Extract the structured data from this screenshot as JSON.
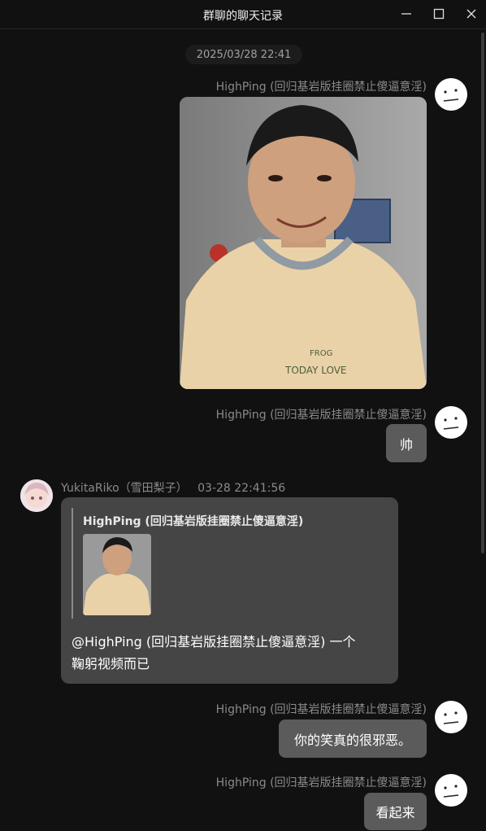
{
  "window": {
    "title": "群聊的聊天记录"
  },
  "timestamp": "2025/03/28 22:41",
  "messages": [
    {
      "sender": "HighPing (回归基岩版挂圈禁止傻逼意淫)",
      "type": "image"
    },
    {
      "sender": "HighPing (回归基岩版挂圈禁止傻逼意淫)",
      "text": "帅"
    },
    {
      "sender": "YukitaRiko（雪田梨子）",
      "time": "03-28 22:41:56",
      "quote_sender": "HighPing (回归基岩版挂圈禁止傻逼意淫)",
      "text_line1": "@HighPing (回归基岩版挂圈禁止傻逼意淫) 一个",
      "text_line2": "鞠躬视频而已"
    },
    {
      "sender": "HighPing (回归基岩版挂圈禁止傻逼意淫)",
      "text": "你的笑真的很邪恶。"
    },
    {
      "sender": "HighPing (回归基岩版挂圈禁止傻逼意淫)",
      "text": "看起来"
    }
  ],
  "colors": {
    "background": "#111111",
    "bubble": "#5b5b5b",
    "reply_bubble": "#454545",
    "sender_text": "#8a8a8a"
  },
  "icons": {
    "minimize": "minimize-icon",
    "maximize": "maximize-icon",
    "close": "close-icon",
    "avatar_highping": "neutral-face-avatar"
  }
}
